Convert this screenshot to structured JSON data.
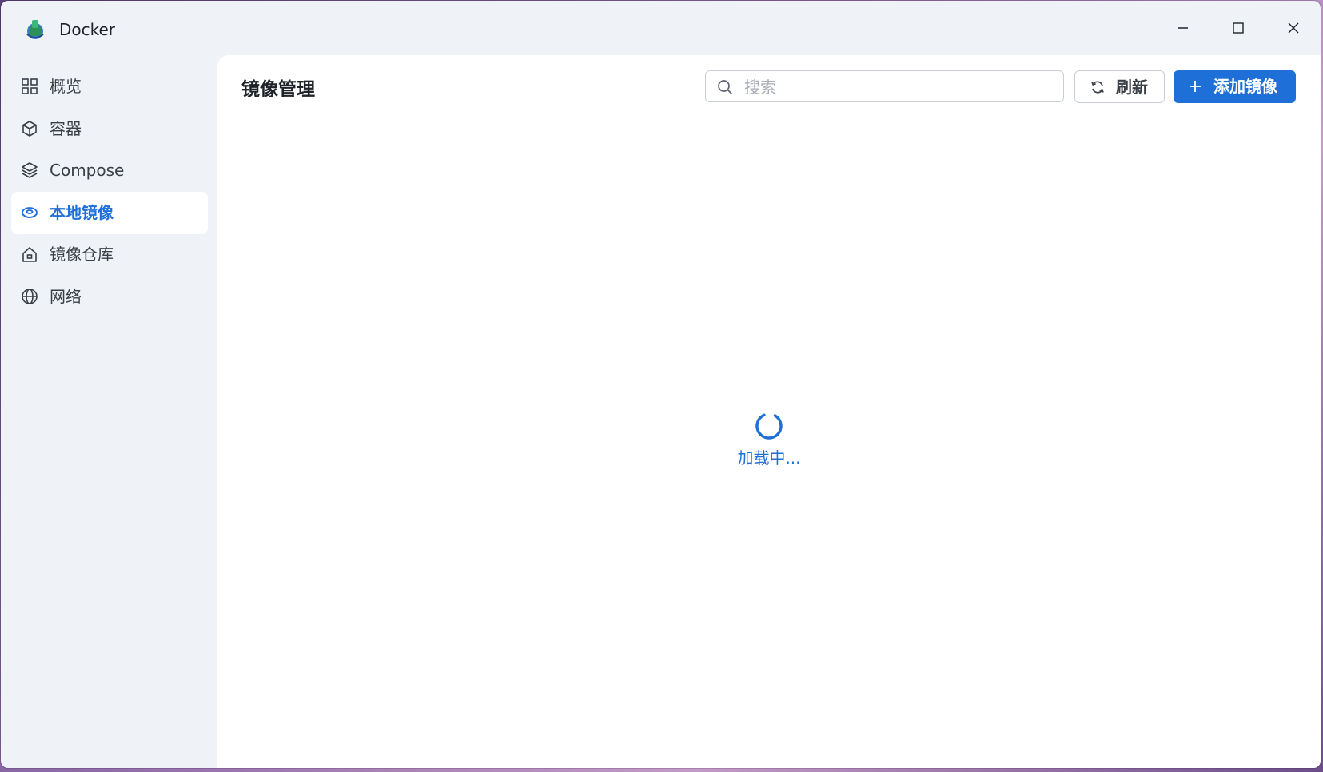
{
  "window": {
    "title": "Docker",
    "controls": [
      "minimize-icon",
      "maximize-icon",
      "close-icon"
    ]
  },
  "sidebar": {
    "items": [
      {
        "label": "概览",
        "icon": "grid-icon",
        "active": false
      },
      {
        "label": "容器",
        "icon": "cube-icon",
        "active": false
      },
      {
        "label": "Compose",
        "icon": "layers-icon",
        "active": false
      },
      {
        "label": "本地镜像",
        "icon": "disk-icon",
        "active": true
      },
      {
        "label": "镜像仓库",
        "icon": "house-icon",
        "active": false
      },
      {
        "label": "网络",
        "icon": "globe-icon",
        "active": false
      }
    ]
  },
  "main": {
    "title": "镜像管理",
    "search": {
      "placeholder": "搜索",
      "value": ""
    },
    "refresh_label": "刷新",
    "add_label": "添加镜像",
    "loading_text": "加载中..."
  },
  "colors": {
    "accent": "#1f6fd9",
    "sidebar_bg": "#eff3f8",
    "content_bg": "#ffffff"
  }
}
